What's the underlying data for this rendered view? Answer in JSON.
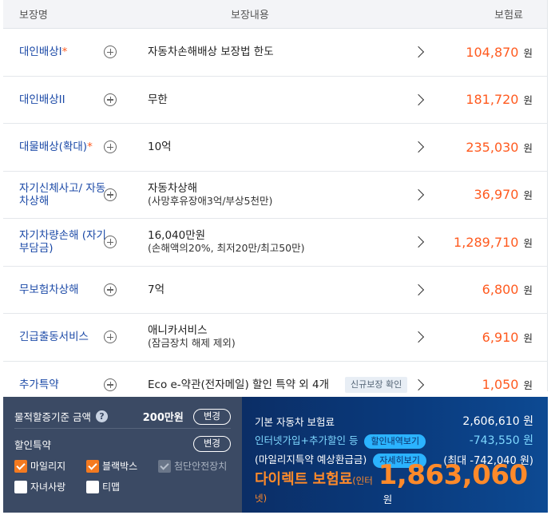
{
  "header": {
    "name": "보장명",
    "content": "보장내용",
    "premium": "보험료"
  },
  "unit": "원",
  "rows": [
    {
      "name": "대인배상I",
      "required": "*",
      "content": "자동차손해배상 보장법 한도",
      "sub": "",
      "tag": "",
      "premium": "104,870"
    },
    {
      "name": "대인배상II",
      "required": "",
      "content": "무한",
      "sub": "",
      "tag": "",
      "premium": "181,720"
    },
    {
      "name": "대물배상(확대)",
      "required": "*",
      "content": "10억",
      "sub": "",
      "tag": "",
      "premium": "235,030"
    },
    {
      "name": "자기신체사고/ 자동차상해",
      "required": "",
      "content": "자동차상해",
      "sub": "(사망후유장애3억/부상5천만)",
      "tag": "",
      "premium": "36,970"
    },
    {
      "name": "자기차량손해 (자기부담금)",
      "required": "",
      "content": "16,040만원",
      "sub": "(손해액의20%, 최저20만/최고50만)",
      "tag": "",
      "premium": "1,289,710"
    },
    {
      "name": "무보험차상해",
      "required": "",
      "content": "7억",
      "sub": "",
      "tag": "",
      "premium": "6,800"
    },
    {
      "name": "긴급출동서비스",
      "required": "",
      "content": "애니카서비스",
      "sub": "(잠금장치 해제 제외)",
      "tag": "",
      "premium": "6,910"
    },
    {
      "name": "추가특약",
      "required": "",
      "content": "Eco e-약관(전자메일) 할인 특약 외 4개",
      "sub": "",
      "tag": "신규보장 확인",
      "premium": "1,050"
    }
  ],
  "options": {
    "property_label": "물적할증기준 금액",
    "property_amount": "200만원",
    "change_label": "변경",
    "discount_label": "할인특약",
    "discount_change_label": "변경",
    "checks": [
      {
        "label": "마일리지",
        "state": "on"
      },
      {
        "label": "블랙박스",
        "state": "on"
      },
      {
        "label": "첨단안전장치",
        "state": "disabled"
      },
      {
        "label": "자녀사랑",
        "state": "off"
      },
      {
        "label": "티맵",
        "state": "off"
      }
    ]
  },
  "summary": {
    "base_label": "기본 자동차 보험료",
    "base_amount": "2,606,610 원",
    "discount_label": "인터넷가입+추가할인 등",
    "discount_pill": "할인내역보기",
    "discount_amount": "-743,550 원",
    "mileage_label": "(마일리지특약 예상환급금)",
    "mileage_pill": "자세히보기",
    "mileage_amount": "(최대 -742,040 원)",
    "final_label": "다이렉트 보험료",
    "final_sub": "(인터넷)",
    "final_amount": "1,863,060",
    "final_unit": "원"
  }
}
